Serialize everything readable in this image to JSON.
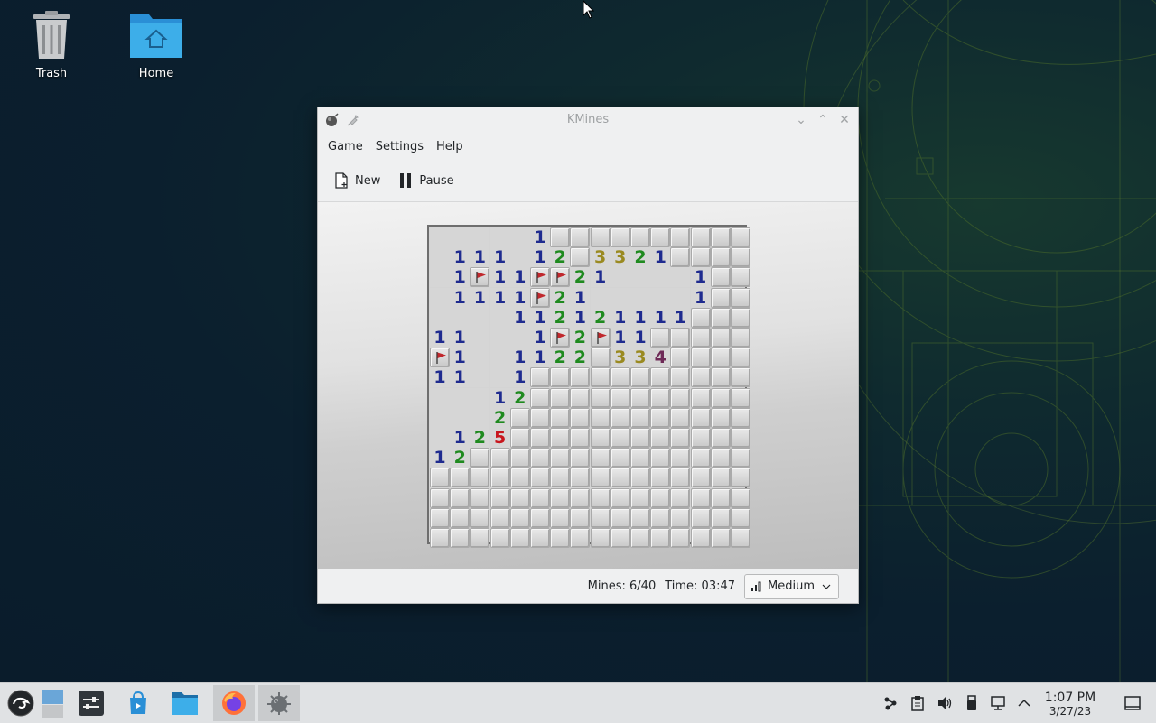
{
  "desktop": {
    "icons": [
      {
        "label": "Trash",
        "icon": "trash-icon"
      },
      {
        "label": "Home",
        "icon": "home-folder-icon"
      }
    ]
  },
  "window": {
    "title": "KMines",
    "menu": [
      "Game",
      "Settings",
      "Help"
    ],
    "toolbar": {
      "new_label": "New",
      "pause_label": "Pause"
    },
    "status": {
      "mines_text": "Mines: 6/40",
      "time_text": "Time: 03:47",
      "difficulty": "Medium"
    }
  },
  "board": {
    "cols": 16,
    "rows": 16,
    "legend": "C=covered, F=flag, .=open empty, digit=open number",
    "grid": [
      ".....1CCCCCCCCCC",
      ".111.12C3321CCCC",
      ".1F11FF21....1CC",
      ".1111F21.....1CC",
      "....112121111CCC",
      "11...1F2F11CCCCC",
      "F1..1122C334CCCC",
      "11..1CCCCCCCCCCC",
      "...12CCCCCCCCCCC",
      "...2CCCCCCCCCCCC",
      ".125CCCCCCCCCCCC",
      "12CCCCCCCCCCCCCC",
      "CCCCCCCCCCCCCCCC",
      "CCCCCCCCCCCCCCCC",
      "CCCCCCCCCCCCCCCC",
      "CCCCCCCCCCCCCCCC"
    ],
    "number_colors": {
      "1": "#1f2b8f",
      "2": "#1f8a1f",
      "3": "#9a8a21",
      "4": "#6e2a57",
      "5": "#c8161d"
    }
  },
  "taskbar": {
    "apps": [
      "opensuse-menu-icon",
      "show-desktop-icon",
      "settings-icon",
      "discover-store-icon",
      "file-manager-icon",
      "firefox-icon",
      "kmines-icon"
    ],
    "tray": [
      "kdeconnect-icon",
      "clipboard-icon",
      "volume-icon",
      "usb-device-icon",
      "network-icon",
      "expand-tray-icon"
    ],
    "clock_time": "1:07 PM",
    "clock_date": "3/27/23"
  }
}
